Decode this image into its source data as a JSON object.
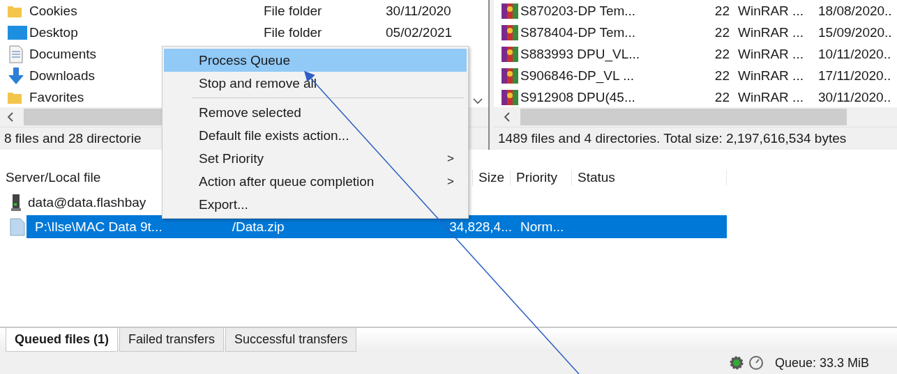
{
  "local_pane": {
    "rows": [
      {
        "kind": "folder",
        "name": "Cookies",
        "type": "File folder",
        "date": "30/11/2020"
      },
      {
        "kind": "desktop",
        "name": "Desktop",
        "type": "File folder",
        "date": "05/02/2021"
      },
      {
        "kind": "documents",
        "name": "Documents",
        "type": "",
        "date": ""
      },
      {
        "kind": "downloads",
        "name": "Downloads",
        "type": "",
        "date": ""
      },
      {
        "kind": "folder",
        "name": "Favorites",
        "type": "",
        "date": ""
      }
    ],
    "status": "8 files and 28 directorie"
  },
  "remote_pane": {
    "rows": [
      {
        "name": "S870203-DP Tem...",
        "size": "22",
        "type": "WinRAR ...",
        "date": "18/08/2020.."
      },
      {
        "name": "S878404-DP Tem...",
        "size": "22",
        "type": "WinRAR ...",
        "date": "15/09/2020.."
      },
      {
        "name": "S883993 DPU_VL...",
        "size": "22",
        "type": "WinRAR ...",
        "date": "10/11/2020.."
      },
      {
        "name": "S906846-DP_VL ...",
        "size": "22",
        "type": "WinRAR ...",
        "date": "17/11/2020.."
      },
      {
        "name": "S912908 DPU(45...",
        "size": "22",
        "type": "WinRAR ...",
        "date": "30/11/2020.."
      }
    ],
    "status": "1489 files and 4 directories. Total size: 2,197,616,534 bytes"
  },
  "queue": {
    "columns": [
      "Server/Local file",
      "Size",
      "Priority",
      "Status"
    ],
    "rows": [
      {
        "kind": "server",
        "local": "data@data.flashbay",
        "remote": "",
        "size": "",
        "priority": "",
        "selected": false
      },
      {
        "kind": "file",
        "local": "P:\\Ilse\\MAC Data 9t...",
        "remote": "/Data.zip",
        "size": "34,828,4...",
        "priority": "Norm...",
        "selected": true
      }
    ]
  },
  "context_menu": {
    "items": [
      {
        "kind": "item",
        "label": "Process Queue",
        "selected": true
      },
      {
        "kind": "item",
        "label": "Stop and remove all",
        "selected": false
      },
      {
        "kind": "separator"
      },
      {
        "kind": "item",
        "label": "Remove selected",
        "selected": false
      },
      {
        "kind": "item",
        "label": "Default file exists action...",
        "selected": false
      },
      {
        "kind": "item",
        "label": "Set Priority",
        "selected": false,
        "arrow": ">"
      },
      {
        "kind": "item",
        "label": "Action after queue completion",
        "selected": false,
        "arrow": ">"
      },
      {
        "kind": "item",
        "label": "Export...",
        "selected": false
      }
    ]
  },
  "tabs": [
    {
      "label": "Queued files (1)",
      "selected": true
    },
    {
      "label": "Failed transfers",
      "selected": false
    },
    {
      "label": "Successful transfers",
      "selected": false
    }
  ],
  "status_bar": {
    "queue": "Queue: 33.3 MiB"
  }
}
